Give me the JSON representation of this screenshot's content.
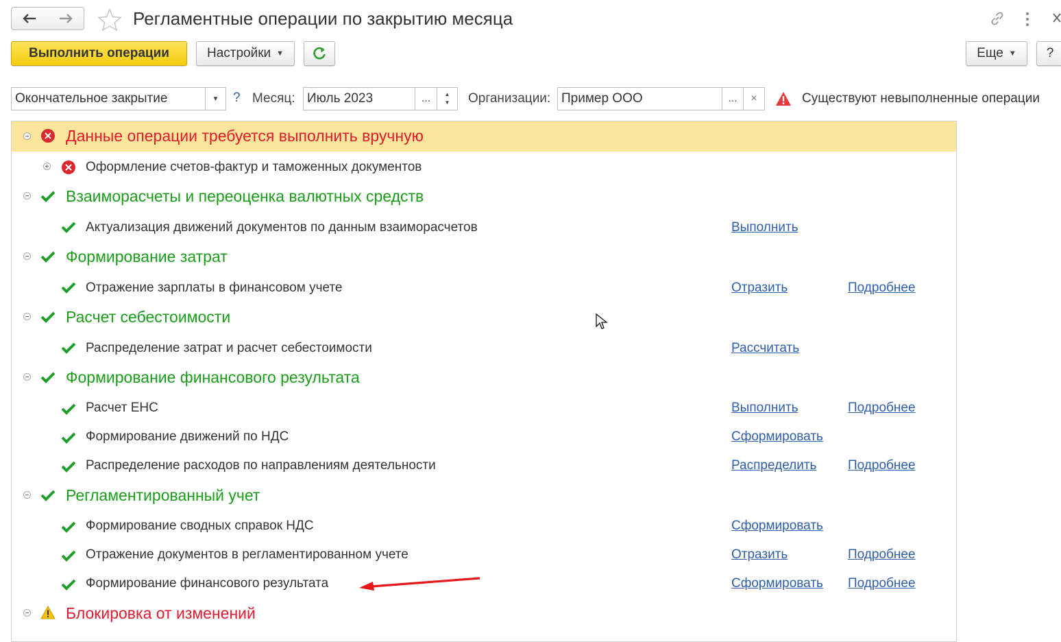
{
  "window": {
    "title": "Регламентные операции по закрытию месяца"
  },
  "toolbar": {
    "run_label": "Выполнить операции",
    "settings_label": "Настройки",
    "more_label": "Еще",
    "help_label": "?"
  },
  "filters": {
    "mode_value": "Окончательное закрытие",
    "mode_help": "?",
    "month_label": "Месяц:",
    "month_value": "Июль 2023",
    "org_label": "Организации:",
    "org_value": "Пример ООО",
    "ellipsis": "...",
    "clear": "×",
    "warning_text": "Существуют невыполненные операции"
  },
  "groups": [
    {
      "title": "Данные операции требуется выполнить вручную",
      "status": "error",
      "items": [
        {
          "label": "Оформление счетов-фактур и таможенных документов",
          "status": "error",
          "action": "",
          "details": ""
        }
      ]
    },
    {
      "title": "Взаиморасчеты и переоценка валютных средств",
      "status": "done",
      "items": [
        {
          "label": "Актуализация движений документов по данным взаиморасчетов",
          "status": "done",
          "action": "Выполнить",
          "details": ""
        }
      ]
    },
    {
      "title": "Формирование затрат",
      "status": "done",
      "items": [
        {
          "label": "Отражение зарплаты в финансовом учете",
          "status": "done",
          "action": "Отразить",
          "details": "Подробнее"
        }
      ]
    },
    {
      "title": "Расчет себестоимости",
      "status": "done",
      "items": [
        {
          "label": "Распределение затрат и расчет себестоимости",
          "status": "done",
          "action": "Рассчитать",
          "details": ""
        }
      ]
    },
    {
      "title": "Формирование финансового результата",
      "status": "done",
      "items": [
        {
          "label": "Расчет ЕНС",
          "status": "done",
          "action": "Выполнить",
          "details": "Подробнее"
        },
        {
          "label": "Формирование движений по НДС",
          "status": "done",
          "action": "Сформировать",
          "details": ""
        },
        {
          "label": "Распределение расходов по направлениям деятельности",
          "status": "done",
          "action": "Распределить",
          "details": "Подробнее"
        }
      ]
    },
    {
      "title": "Регламентированный учет",
      "status": "done",
      "items": [
        {
          "label": "Формирование сводных справок НДС",
          "status": "done",
          "action": "Сформировать",
          "details": ""
        },
        {
          "label": "Отражение документов в регламентированном учете",
          "status": "done",
          "action": "Отразить",
          "details": "Подробнее"
        },
        {
          "label": "Формирование финансового результата",
          "status": "done",
          "action": "Сформировать",
          "details": "Подробнее"
        }
      ]
    },
    {
      "title": "Блокировка от изменений",
      "status": "warning",
      "items": []
    }
  ],
  "colors": {
    "error": "#e01b2f",
    "done": "#1a9e1a",
    "warning": "#f4c20d",
    "link": "#2f5da8",
    "highlight": "#fbe59a",
    "primary_button": "#f4cc0e"
  }
}
